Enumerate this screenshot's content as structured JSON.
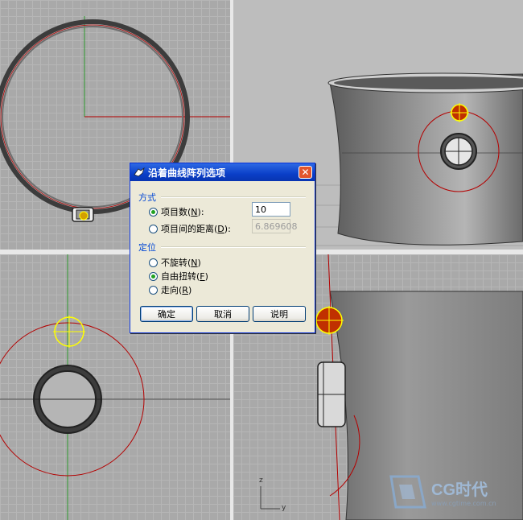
{
  "dialog": {
    "title": "沿着曲线阵列选项",
    "close_glyph": "✕",
    "group_method": "方式",
    "option_count_label": "项目数(",
    "option_count_key": "N",
    "option_count_tail": "):",
    "option_count_value": "10",
    "option_distance_label": "项目间的距离(",
    "option_distance_key": "D",
    "option_distance_tail": "):",
    "option_distance_value": "6.869608",
    "group_orient": "定位",
    "orient_norotate_label": "不旋转(",
    "orient_norotate_key": "N",
    "orient_freeform_label": "自由扭转(",
    "orient_freeform_key": "F",
    "orient_roadlike_label": "走向(",
    "orient_roadlike_key": "R",
    "close_paren": ")",
    "ok_label": "确定",
    "cancel_label": "取消",
    "help_label": "说明"
  },
  "selected": {
    "method": "count",
    "orient": "freeform"
  },
  "axis_labels": {
    "z": "z",
    "y": "y"
  },
  "watermark": {
    "brand": "CG时代",
    "url": "www.cgtime.com.cn"
  },
  "colors": {
    "dialog_title_bar": "#0a3fc8",
    "curve_red": "#b40000",
    "gizmo_yellow": "#ffff00"
  }
}
